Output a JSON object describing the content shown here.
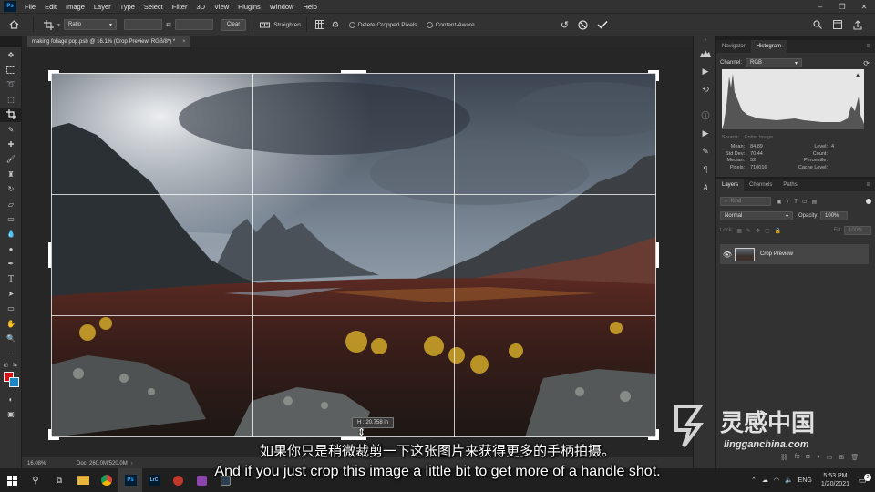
{
  "menubar": {
    "logo": "Ps",
    "items": [
      "File",
      "Edit",
      "Image",
      "Layer",
      "Type",
      "Select",
      "Filter",
      "3D",
      "View",
      "Plugins",
      "Window",
      "Help"
    ],
    "window_controls": [
      "–",
      "❐",
      "✕"
    ]
  },
  "options": {
    "ratio_value": "Ratio",
    "clear_label": "Clear",
    "straighten_label": "Straighten",
    "delete_cropped_label": "Delete Cropped Pixels",
    "content_aware_label": "Content-Aware"
  },
  "document": {
    "tab_title": "making foliage pop.psb @ 16.1% (Crop Preview, RGB/8*) *",
    "tab_close": "×",
    "height_readout": "H : 20.758 in",
    "zoom": "16.08%",
    "doc_info": "Doc: 260.0M/520.0M"
  },
  "histogram_panel": {
    "tabs": [
      "Navigator",
      "Histogram"
    ],
    "channel_label": "Channel:",
    "channel_value": "RGB",
    "source_label": "Source:",
    "source_value": "Entire Image",
    "stats_left": [
      {
        "label": "Mean:",
        "value": "84.89"
      },
      {
        "label": "Std Dev:",
        "value": "70.44"
      },
      {
        "label": "Median:",
        "value": "52"
      },
      {
        "label": "Pixels:",
        "value": "710016"
      }
    ],
    "stats_right": [
      {
        "label": "Level:",
        "value": ""
      },
      {
        "label": "Count:",
        "value": ""
      },
      {
        "label": "Percentile:",
        "value": ""
      },
      {
        "label": "Cache Level:",
        "value": "4"
      }
    ]
  },
  "layers_panel": {
    "tabs": [
      "Layers",
      "Channels",
      "Paths"
    ],
    "kind_label": "Kind",
    "blend_mode": "Normal",
    "opacity_label": "Opacity:",
    "opacity_value": "100%",
    "lock_label": "Lock:",
    "fill_label": "Fill:",
    "fill_value": "100%",
    "layers": [
      {
        "name": "Crop Preview",
        "visible": true
      }
    ]
  },
  "subtitles": {
    "chinese": "如果你只是稍微裁剪一下这张图片来获得更多的手柄拍摄。",
    "english": "And if you just crop this image a little bit to get more of a handle shot."
  },
  "watermark": {
    "brand_cn": "灵感中国",
    "url": "lingganchina.com"
  },
  "taskbar": {
    "language": "ENG",
    "time": "5:53 PM",
    "date": "1/20/2021",
    "notifications": "2",
    "app_labels": [
      "Ps",
      "LrC"
    ]
  },
  "colors": {
    "foreground": "#d11515",
    "background": "#1a86c4",
    "ps_blue": "#31a8ff"
  }
}
